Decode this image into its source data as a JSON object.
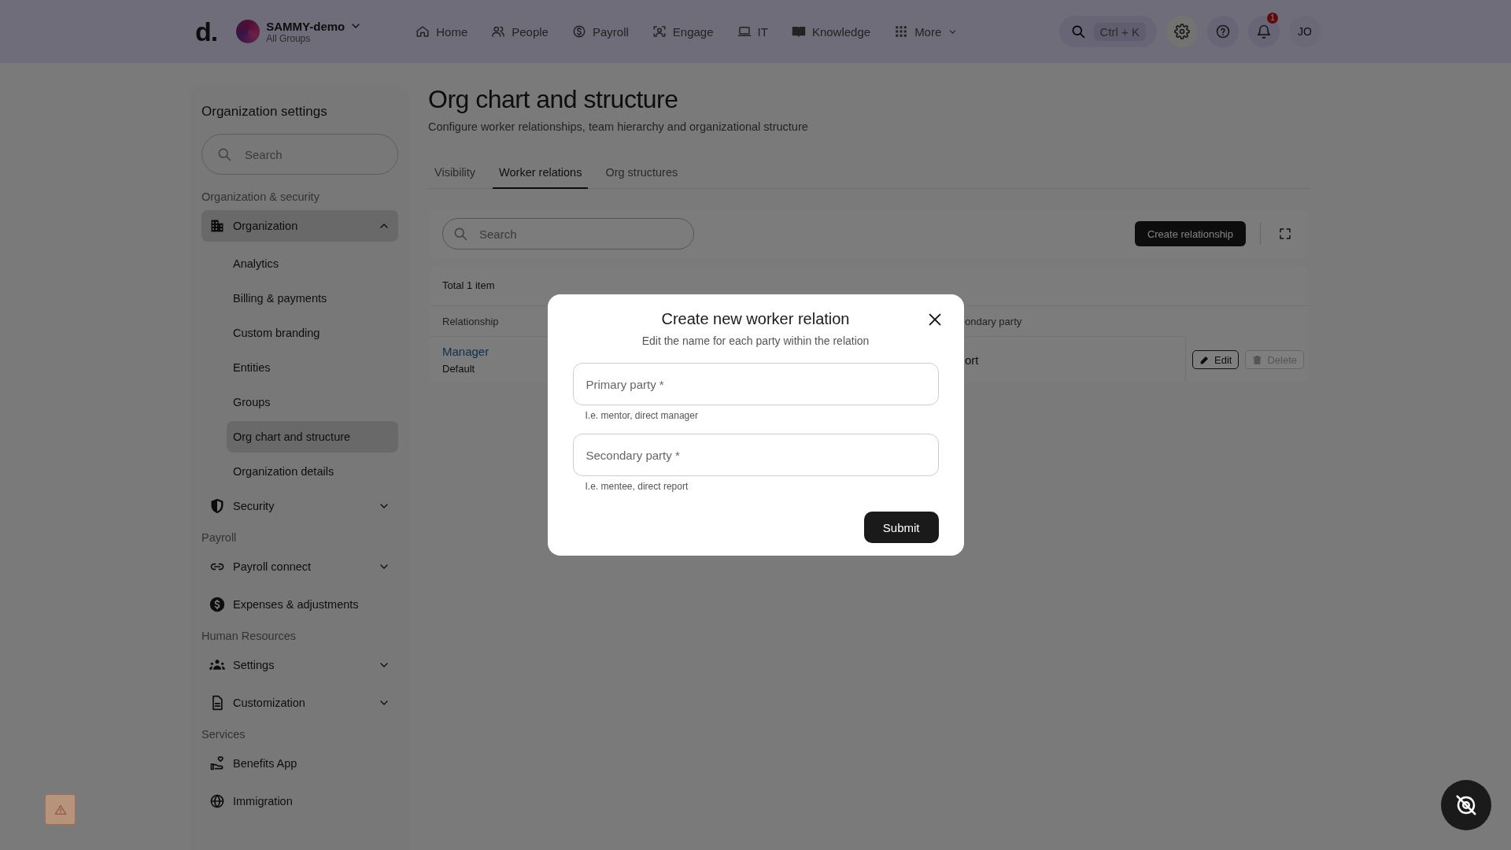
{
  "header": {
    "logo": "d.",
    "workspace": {
      "name": "SAMMY-demo",
      "subtitle": "All Groups"
    },
    "nav": [
      {
        "label": "Home"
      },
      {
        "label": "People"
      },
      {
        "label": "Payroll"
      },
      {
        "label": "Engage"
      },
      {
        "label": "IT"
      },
      {
        "label": "Knowledge"
      },
      {
        "label": "More"
      }
    ],
    "search": {
      "shortcut": "Ctrl + K"
    },
    "notification_count": "1",
    "avatar": "JO"
  },
  "sidebar": {
    "title": "Organization settings",
    "search": {
      "placeholder": "Search"
    },
    "sections": [
      {
        "heading": "Organization & security",
        "items": [
          {
            "label": "Organization",
            "selected": true,
            "expanded": true,
            "children": [
              {
                "label": "Analytics",
                "selected": false
              },
              {
                "label": "Billing & payments",
                "selected": false
              },
              {
                "label": "Custom branding",
                "selected": false
              },
              {
                "label": "Entities",
                "selected": false
              },
              {
                "label": "Groups",
                "selected": false
              },
              {
                "label": "Org chart and structure",
                "selected": true
              },
              {
                "label": "Organization details",
                "selected": false
              }
            ]
          },
          {
            "label": "Security",
            "selected": false,
            "expanded": false
          }
        ]
      },
      {
        "heading": "Payroll",
        "items": [
          {
            "label": "Payroll connect",
            "selected": false,
            "expanded": false
          },
          {
            "label": "Expenses & adjustments",
            "selected": false
          }
        ]
      },
      {
        "heading": "Human Resources",
        "items": [
          {
            "label": "Settings",
            "selected": false,
            "expanded": false
          },
          {
            "label": "Customization",
            "selected": false,
            "expanded": false
          }
        ]
      },
      {
        "heading": "Services",
        "items": [
          {
            "label": "Benefits App",
            "selected": false
          },
          {
            "label": "Immigration",
            "selected": false
          }
        ]
      }
    ]
  },
  "page": {
    "title": "Org chart and structure",
    "subtitle": "Configure worker relationships, team hierarchy and organizational structure",
    "tabs": [
      {
        "label": "Visibility",
        "selected": false
      },
      {
        "label": "Worker relations",
        "selected": true
      },
      {
        "label": "Org structures",
        "selected": false
      }
    ],
    "toolbar": {
      "search": {
        "placeholder": "Search"
      },
      "create_button": "Create relationship"
    },
    "table": {
      "total": "Total 1 item",
      "columns": [
        "Relationship",
        "ondary party"
      ],
      "rows": [
        {
          "relationship": "Manager",
          "tag": "Default",
          "column_2": "ort",
          "actions": [
            {
              "label": "Edit",
              "disabled": false
            },
            {
              "label": "Delete",
              "disabled": true
            }
          ]
        }
      ]
    }
  },
  "modal": {
    "title": "Create new worker relation",
    "subtitle": "Edit the name for each party within the relation",
    "fields": [
      {
        "placeholder": "Primary party *",
        "hint": "I.e. mentor, direct manager"
      },
      {
        "placeholder": "Secondary party *",
        "hint": "I.e. mentee, direct report"
      }
    ],
    "submit": "Submit"
  }
}
